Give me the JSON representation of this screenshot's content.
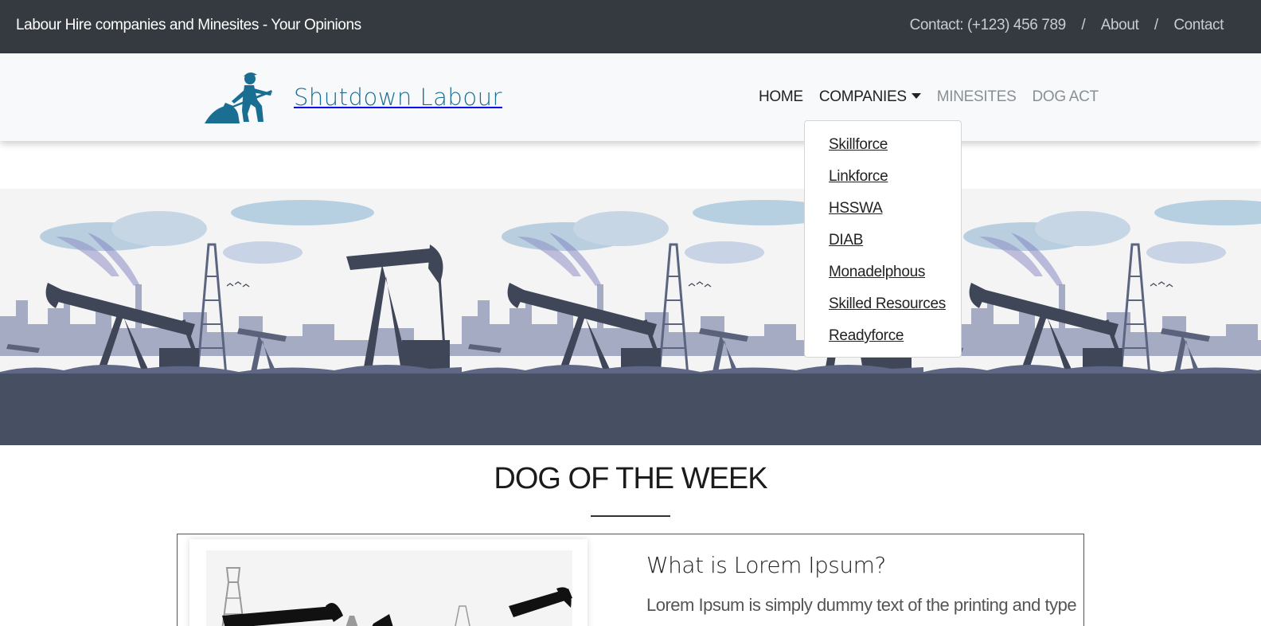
{
  "topbar": {
    "site_title": "Labour Hire companies and Minesites - Your Opinions",
    "contact_text": "Contact: (+123) 456 789",
    "separator": "/",
    "about_label": "About",
    "contact_label": "Contact"
  },
  "brand": {
    "name": "Shutdown Labour",
    "logo_icon": "worker-shoveling-icon",
    "color": "#1a6e92"
  },
  "nav": {
    "items": [
      {
        "label": "HOME"
      },
      {
        "label": "COMPANIES"
      },
      {
        "label": "MINESITES"
      },
      {
        "label": "DOG ACT"
      }
    ]
  },
  "companies_dropdown": {
    "items": [
      {
        "label": "Skillforce"
      },
      {
        "label": "Linkforce"
      },
      {
        "label": "HSSWA"
      },
      {
        "label": "DIAB"
      },
      {
        "label": "Monadelphous"
      },
      {
        "label": "Skilled Resources"
      },
      {
        "label": "Readyforce"
      }
    ]
  },
  "hero": {
    "image": "oil-pumpjacks-illustration",
    "colors": {
      "ground": "#474f63",
      "silhouette": "#3f4658",
      "sky": "#f4f4f5"
    }
  },
  "section": {
    "title": "DOG OF THE WEEK"
  },
  "card": {
    "heading": "What is Lorem Ipsum?",
    "text": "Lorem Ipsum is simply dummy text of the printing and typesetting",
    "image": "pumpjack-silhouette"
  },
  "colors": {
    "topbar_bg": "#343a40",
    "navbar_bg": "#f8f9fa"
  }
}
